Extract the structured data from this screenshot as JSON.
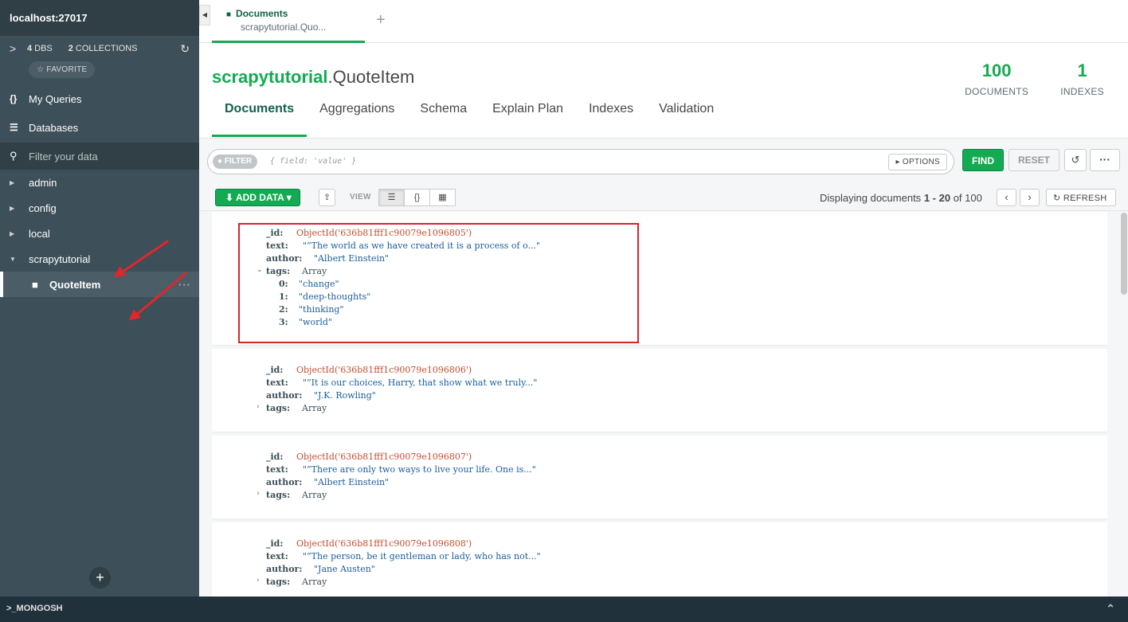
{
  "sidebar": {
    "host": "localhost:27017",
    "dbs_count": "4",
    "dbs_label": "DBS",
    "collections_count": "2",
    "collections_label": "COLLECTIONS",
    "favorite_label": "☆ FAVORITE",
    "my_queries_label": "My Queries",
    "databases_label": "Databases",
    "filter_placeholder": "Filter your data",
    "databases": [
      {
        "name": "admin"
      },
      {
        "name": "config"
      },
      {
        "name": "local"
      },
      {
        "name": "scrapytutorial"
      }
    ],
    "active_collection": "QuoteItem",
    "annotation_color": "#e0262c"
  },
  "bottom_bar": {
    "label": ">_MONGOSH"
  },
  "tab": {
    "title": "Documents",
    "subtitle": "scrapytutorial.Quo..."
  },
  "header": {
    "db_name": "scrapytutorial",
    "separator": ".",
    "collection_name": "QuoteItem",
    "documents_count": "100",
    "documents_label": "DOCUMENTS",
    "indexes_count": "1",
    "indexes_label": "INDEXES",
    "accent_color": "#13aa52"
  },
  "subtabs": [
    "Documents",
    "Aggregations",
    "Schema",
    "Explain Plan",
    "Indexes",
    "Validation"
  ],
  "query_bar": {
    "filter_pill": "FILTER",
    "placeholder": "{ field: 'value' }",
    "options_label": "OPTIONS",
    "find_label": "FIND",
    "reset_label": "RESET",
    "more_label": "···"
  },
  "toolbar": {
    "add_data_label": "ADD DATA",
    "view_label": "VIEW",
    "displaying_prefix": "Displaying documents",
    "range": "1 - 20",
    "of_label": "of",
    "total": "100",
    "refresh_label": "REFRESH"
  },
  "documents": [
    {
      "id_key": "_id",
      "id_value": "ObjectId('636b81fff1c90079e1096805')",
      "text_key": "text",
      "text_value": "\"“The world as we have created it is a process of o...\"",
      "author_key": "author",
      "author_value": "\"Albert Einstein\"",
      "tags_key": "tags",
      "tags_type": "Array",
      "tags": [
        "\"change\"",
        "\"deep-thoughts\"",
        "\"thinking\"",
        "\"world\""
      ]
    },
    {
      "id_key": "_id",
      "id_value": "ObjectId('636b81fff1c90079e1096806')",
      "text_key": "text",
      "text_value": "\"“It is our choices, Harry, that show what we truly...\"",
      "author_key": "author",
      "author_value": "\"J.K. Rowling\"",
      "tags_key": "tags",
      "tags_type": "Array"
    },
    {
      "id_key": "_id",
      "id_value": "ObjectId('636b81fff1c90079e1096807')",
      "text_key": "text",
      "text_value": "\"“There are only two ways to live your life. One is...\"",
      "author_key": "author",
      "author_value": "\"Albert Einstein\"",
      "tags_key": "tags",
      "tags_type": "Array"
    },
    {
      "id_key": "_id",
      "id_value": "ObjectId('636b81fff1c90079e1096808')",
      "text_key": "text",
      "text_value": "\"“The person, be it gentleman or lady, who has not...\"",
      "author_key": "author",
      "author_value": "\"Jane Austen\"",
      "tags_key": "tags",
      "tags_type": "Array"
    }
  ]
}
